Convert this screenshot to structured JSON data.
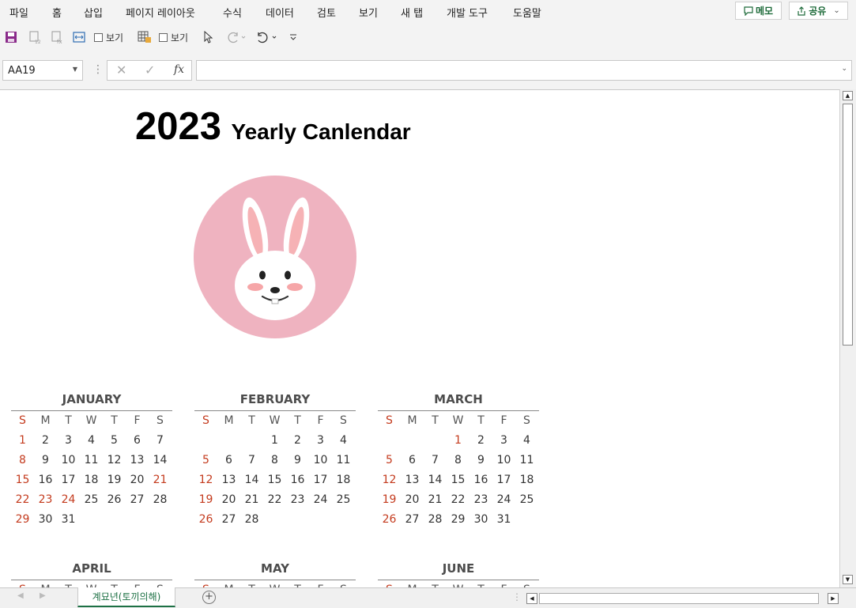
{
  "menu": [
    "파일",
    "홈",
    "삽입",
    "페이지 레이아웃",
    "수식",
    "데이터",
    "검토",
    "보기",
    "새 탭",
    "개발 도구",
    "도움말"
  ],
  "memo_label": "메모",
  "share_label": "공유",
  "qat": {
    "view1": "보기",
    "view2": "보기"
  },
  "namebox": "AA19",
  "title": {
    "year": "2023",
    "rest": "Yearly Canlendar"
  },
  "dow": [
    "S",
    "M",
    "T",
    "W",
    "T",
    "F",
    "S"
  ],
  "months": [
    {
      "name": "JANUARY",
      "weeks": [
        [
          "1",
          "2",
          "3",
          "4",
          "5",
          "6",
          "7"
        ],
        [
          "8",
          "9",
          "10",
          "11",
          "12",
          "13",
          "14"
        ],
        [
          "15",
          "16",
          "17",
          "18",
          "19",
          "20",
          "21"
        ],
        [
          "22",
          "23",
          "24",
          "25",
          "26",
          "27",
          "28"
        ],
        [
          "29",
          "30",
          "31",
          "",
          "",
          "",
          ""
        ]
      ],
      "red": [
        "1",
        "8",
        "15",
        "21",
        "22",
        "23",
        "24",
        "29"
      ]
    },
    {
      "name": "FEBRUARY",
      "weeks": [
        [
          "",
          "",
          "",
          "1",
          "2",
          "3",
          "4"
        ],
        [
          "5",
          "6",
          "7",
          "8",
          "9",
          "10",
          "11"
        ],
        [
          "12",
          "13",
          "14",
          "15",
          "16",
          "17",
          "18"
        ],
        [
          "19",
          "20",
          "21",
          "22",
          "23",
          "24",
          "25"
        ],
        [
          "26",
          "27",
          "28",
          "",
          "",
          "",
          ""
        ]
      ],
      "red": [
        "5",
        "12",
        "19",
        "26"
      ]
    },
    {
      "name": "MARCH",
      "weeks": [
        [
          "",
          "",
          "",
          "1",
          "2",
          "3",
          "4"
        ],
        [
          "5",
          "6",
          "7",
          "8",
          "9",
          "10",
          "11"
        ],
        [
          "12",
          "13",
          "14",
          "15",
          "16",
          "17",
          "18"
        ],
        [
          "19",
          "20",
          "21",
          "22",
          "23",
          "24",
          "25"
        ],
        [
          "26",
          "27",
          "28",
          "29",
          "30",
          "31",
          ""
        ]
      ],
      "red": [
        "1",
        "5",
        "12",
        "19",
        "26"
      ]
    },
    {
      "name": "APRIL",
      "weeks": [],
      "red": []
    },
    {
      "name": "MAY",
      "weeks": [],
      "red": []
    },
    {
      "name": "JUNE",
      "weeks": [],
      "red": []
    }
  ],
  "sheet_tab": "계묘년(토끼의해)",
  "colors": {
    "red": "#c43b1e",
    "circle": "#efb3c0",
    "accent": "#1e7145"
  }
}
